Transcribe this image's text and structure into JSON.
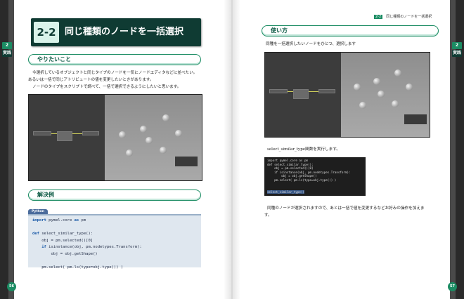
{
  "left_page": {
    "tab_num": "2",
    "tab_label": "実践",
    "page_number": "56",
    "chapter": {
      "number": "2-2",
      "title": "同じ種類のノードを一括選択"
    },
    "section_goal": {
      "title": "やりたいこと"
    },
    "goal_text": [
      "今選択しているオブジェクトと同じタイプのノードを一気にノードエディタなどに並べたい。",
      "あるいは一括で同じアトリビュートの値を変更したいときがあります。",
      "ノードのタイプをスクリプトで調べて、一括で選択できるようにしたいと思います。"
    ],
    "section_solution": {
      "title": "解決例"
    },
    "code_lang": "Python",
    "code": [
      {
        "kw": "import",
        "text": " pymel.core ",
        "kw2": "as",
        "text2": " pm"
      },
      {
        "kw": "",
        "text": ""
      },
      {
        "kw": "def",
        "text": " select_similar_type():"
      },
      {
        "kw": "",
        "text": "    obj = pm.selected()[0]"
      },
      {
        "kw": "    if",
        "text": " isinstance(obj, pm.nodetypes.Transform):"
      },
      {
        "kw": "",
        "text": "        obj = obj.getShape()"
      },
      {
        "kw": "",
        "text": ""
      },
      {
        "kw": "",
        "text": "    pm.select( pm.ls(type=obj.type()) )"
      }
    ]
  },
  "right_page": {
    "tab_num": "2",
    "tab_label": "実践",
    "page_number": "57",
    "header_badge": "2-2",
    "header_title": "同じ種類のノードを一括選択",
    "section_usage": {
      "title": "使い方"
    },
    "usage_text_1": "同種を一括選択したいノードをひとつ、選択します",
    "usage_text_2": "select_similar_type関数を実行します。",
    "usage_text_3": "同種のノードが選択されますので、あとは一括で値を変更するなどお好みの操作を加えま",
    "usage_text_4": "す。",
    "code_lines": [
      "import pymel.core as pm",
      "",
      "def select_similar_type():",
      "    obj = pm.selected()[0]",
      "    if isinstance(obj, pm.nodetypes.Transform):",
      "        obj = obj.getShape()",
      "",
      "    pm.select( pm.ls(type=obj.type()) )",
      "",
      "select_similar_type()"
    ]
  }
}
